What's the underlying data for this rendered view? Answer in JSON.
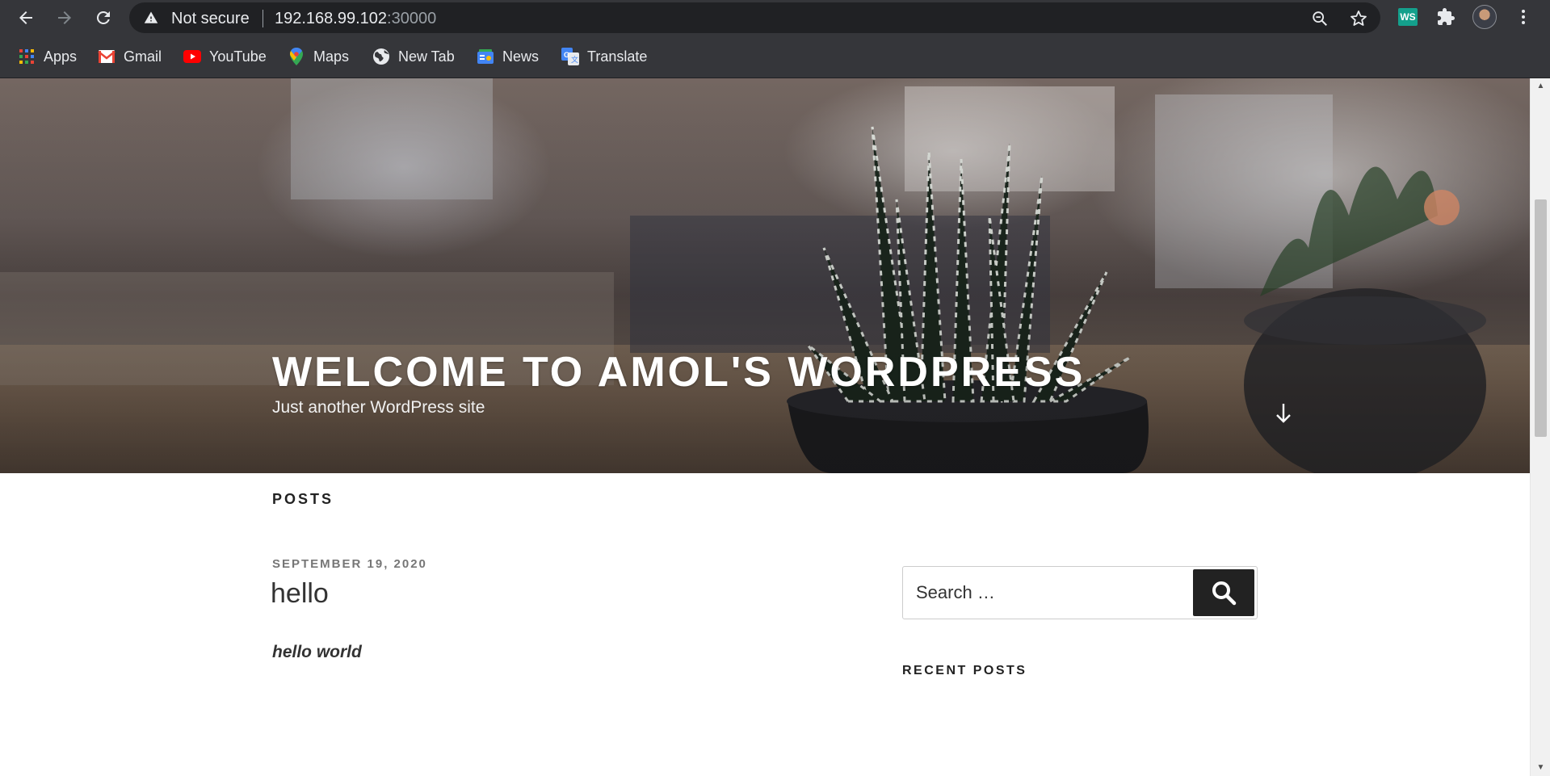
{
  "browser": {
    "security_label": "Not secure",
    "url_host": "192.168.99.102",
    "url_port": ":30000",
    "extension_badge": "WS"
  },
  "bookmarks": [
    {
      "label": "Apps",
      "icon": "apps-grid-icon"
    },
    {
      "label": "Gmail",
      "icon": "gmail-icon"
    },
    {
      "label": "YouTube",
      "icon": "youtube-icon"
    },
    {
      "label": "Maps",
      "icon": "maps-pin-icon"
    },
    {
      "label": "New Tab",
      "icon": "globe-icon"
    },
    {
      "label": "News",
      "icon": "news-icon"
    },
    {
      "label": "Translate",
      "icon": "translate-icon"
    }
  ],
  "site": {
    "title": "WELCOME TO AMOL'S WORDPRESS",
    "description": "Just another WordPress site"
  },
  "content": {
    "section_title": "POSTS",
    "post": {
      "date": "SEPTEMBER 19, 2020",
      "title": "hello",
      "excerpt": "hello world"
    }
  },
  "sidebar": {
    "search_placeholder": "Search …",
    "recent_posts_title": "RECENT POSTS"
  },
  "colors": {
    "toolbar_bg": "#35363a",
    "omnibox_bg": "#202124",
    "accent_dark": "#222222"
  }
}
